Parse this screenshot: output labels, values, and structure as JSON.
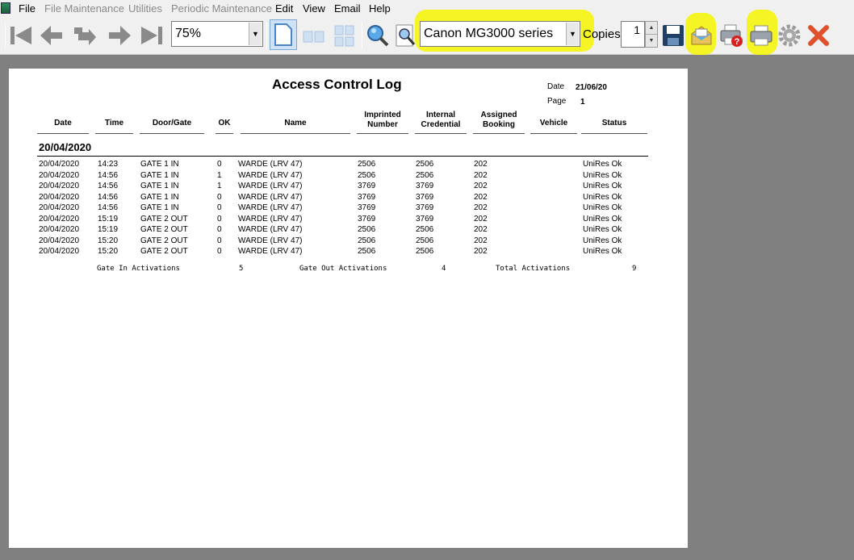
{
  "menu": {
    "items": [
      {
        "label": "File",
        "enabled": true
      },
      {
        "label": "File Maintenance",
        "enabled": false
      },
      {
        "label": "Utilities",
        "enabled": false
      },
      {
        "label": "Periodic Maintenance",
        "enabled": false
      },
      {
        "label": "Edit",
        "enabled": true
      },
      {
        "label": "View",
        "enabled": true
      },
      {
        "label": "Email",
        "enabled": true
      },
      {
        "label": "Help",
        "enabled": true
      }
    ]
  },
  "toolbar": {
    "zoom": "75%",
    "printer": "Canon MG3000 series",
    "copies_label": "Copies",
    "copies_value": "1",
    "icons": [
      "first-page-icon",
      "previous-page-icon",
      "go-to-page-icon",
      "next-page-icon",
      "last-page-icon",
      "single-page-icon",
      "two-page-icon",
      "multi-page-icon",
      "zoom-icon",
      "zoom-page-icon",
      "save-icon",
      "email-icon",
      "printer-help-icon",
      "print-icon",
      "settings-icon",
      "close-icon"
    ],
    "highlight_color": "#f4f41a"
  },
  "report": {
    "title": "Access Control Log",
    "date_label": "Date",
    "date_value": "21/06/20",
    "page_label": "Page",
    "page_value": "1",
    "headers": {
      "date": "Date",
      "time": "Time",
      "door": "Door/Gate",
      "ok": "OK",
      "name": "Name",
      "imprinted_1": "Imprinted",
      "imprinted_2": "Number",
      "internal_1": "Internal",
      "internal_2": "Credential",
      "assigned_1": "Assigned",
      "assigned_2": "Booking",
      "vehicle": "Vehicle",
      "status": "Status"
    },
    "group_date": "20/04/2020",
    "rows": [
      {
        "date": "20/04/2020",
        "time": "14:23",
        "door": "GATE 1 IN",
        "ok": "0",
        "name": "WARDE (LRV  47)",
        "imprinted": "2506",
        "internal": "2506",
        "booking": "202",
        "vehicle": "",
        "status": "UniRes Ok"
      },
      {
        "date": "20/04/2020",
        "time": "14:56",
        "door": "GATE 1 IN",
        "ok": "1",
        "name": "WARDE (LRV  47)",
        "imprinted": "2506",
        "internal": "2506",
        "booking": "202",
        "vehicle": "",
        "status": "UniRes Ok"
      },
      {
        "date": "20/04/2020",
        "time": "14:56",
        "door": "GATE 1 IN",
        "ok": "1",
        "name": "WARDE (LRV  47)",
        "imprinted": "3769",
        "internal": "3769",
        "booking": "202",
        "vehicle": "",
        "status": "UniRes Ok"
      },
      {
        "date": "20/04/2020",
        "time": "14:56",
        "door": "GATE 1 IN",
        "ok": "0",
        "name": "WARDE (LRV  47)",
        "imprinted": "3769",
        "internal": "3769",
        "booking": "202",
        "vehicle": "",
        "status": "UniRes Ok"
      },
      {
        "date": "20/04/2020",
        "time": "14:56",
        "door": "GATE 1 IN",
        "ok": "0",
        "name": "WARDE (LRV  47)",
        "imprinted": "3769",
        "internal": "3769",
        "booking": "202",
        "vehicle": "",
        "status": "UniRes Ok"
      },
      {
        "date": "20/04/2020",
        "time": "15:19",
        "door": "GATE 2 OUT",
        "ok": "0",
        "name": "WARDE (LRV  47)",
        "imprinted": "3769",
        "internal": "3769",
        "booking": "202",
        "vehicle": "",
        "status": "UniRes Ok"
      },
      {
        "date": "20/04/2020",
        "time": "15:19",
        "door": "GATE 2 OUT",
        "ok": "0",
        "name": "WARDE (LRV  47)",
        "imprinted": "2506",
        "internal": "2506",
        "booking": "202",
        "vehicle": "",
        "status": "UniRes Ok"
      },
      {
        "date": "20/04/2020",
        "time": "15:20",
        "door": "GATE 2 OUT",
        "ok": "0",
        "name": "WARDE (LRV  47)",
        "imprinted": "2506",
        "internal": "2506",
        "booking": "202",
        "vehicle": "",
        "status": "UniRes Ok"
      },
      {
        "date": "20/04/2020",
        "time": "15:20",
        "door": "GATE 2 OUT",
        "ok": "0",
        "name": "WARDE (LRV  47)",
        "imprinted": "2506",
        "internal": "2506",
        "booking": "202",
        "vehicle": "",
        "status": "UniRes Ok"
      }
    ],
    "totals": {
      "in_label": "Gate In Activations",
      "in_value": "5",
      "out_label": "Gate Out Activations",
      "out_value": "4",
      "total_label": "Total Activations",
      "total_value": "9"
    }
  }
}
